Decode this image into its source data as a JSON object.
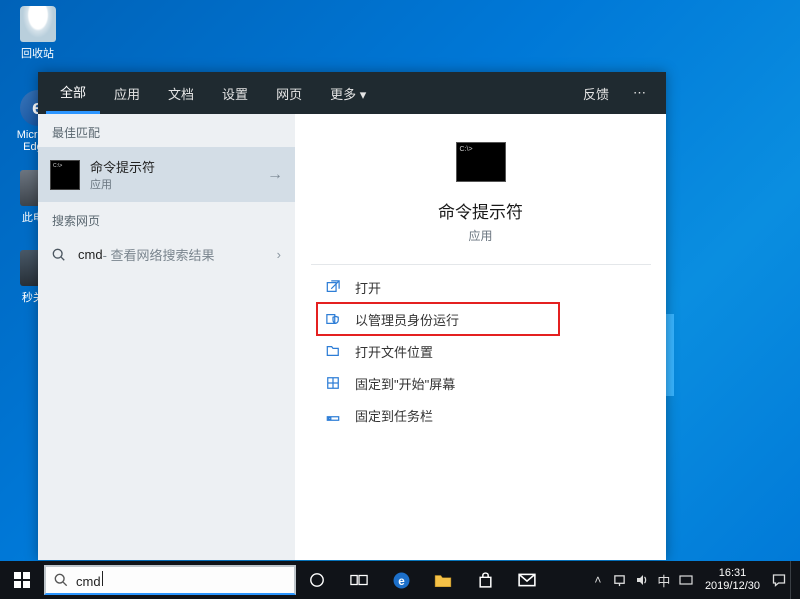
{
  "desktop": {
    "icons": {
      "recycle": "回收站",
      "edge_line1": "Micros...",
      "edge_line2": "Edg...",
      "this_pc": "此电...",
      "net": "秒关..."
    }
  },
  "search_panel": {
    "tabs": {
      "all": "全部",
      "apps": "应用",
      "documents": "文档",
      "settings": "设置",
      "web": "网页",
      "more": "更多 ▾",
      "feedback": "反馈"
    },
    "best_match_label": "最佳匹配",
    "best_match": {
      "title": "命令提示符",
      "subtitle": "应用"
    },
    "search_web_label": "搜索网页",
    "search_web_item": {
      "query": "cmd",
      "suffix": " - 查看网络搜索结果"
    },
    "preview": {
      "title": "命令提示符",
      "subtitle": "应用"
    },
    "actions": {
      "open": "打开",
      "run_admin": "以管理员身份运行",
      "open_location": "打开文件位置",
      "pin_start": "固定到\"开始\"屏幕",
      "pin_taskbar": "固定到任务栏"
    }
  },
  "taskbar": {
    "search_value": "cmd",
    "tray": {
      "ime": "中",
      "time": "16:31",
      "date": "2019/12/30"
    }
  }
}
